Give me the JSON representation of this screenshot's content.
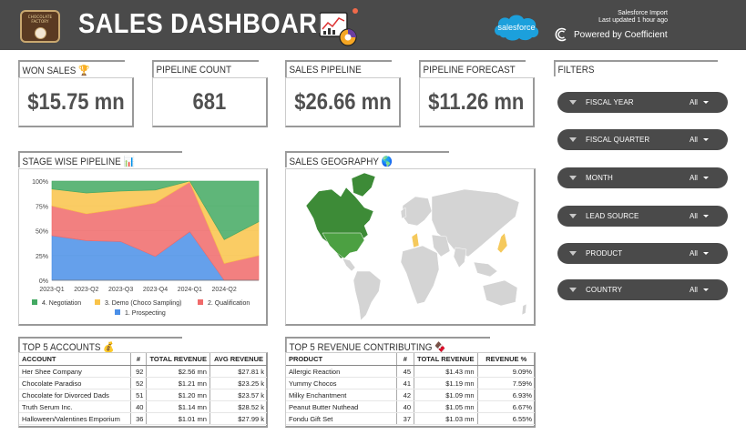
{
  "header": {
    "title": "SALES DASHBOARD",
    "logo_text": "CHOCOLATE FACTORY",
    "integration": "Salesforce Import",
    "last_updated": "Last updated 1 hour ago",
    "salesforce_logo": "salesforce",
    "powered_by": "Powered by Coefficient"
  },
  "kpis": {
    "won_sales": {
      "label": "WON SALES 🏆",
      "value": "$15.75 mn"
    },
    "pipeline_count": {
      "label": "PIPELINE COUNT",
      "value": "681"
    },
    "sales_pipeline": {
      "label": "SALES PIPELINE",
      "value": "$26.66 mn"
    },
    "pipeline_forecast": {
      "label": "PIPELINE FORECAST",
      "value": "$11.26 mn"
    }
  },
  "sections": {
    "stage_pipeline": "STAGE WISE PIPELINE 📊",
    "sales_geography": "SALES GEOGRAPHY 🌎",
    "top_accounts": "TOP 5 ACCOUNTS 💰",
    "top_revenue": "TOP 5 REVENUE CONTRIBUTING 🍫",
    "filters": "FILTERS"
  },
  "filters": [
    {
      "name": "FISCAL YEAR",
      "value": "All"
    },
    {
      "name": "FISCAL QUARTER",
      "value": "All"
    },
    {
      "name": "MONTH",
      "value": "All"
    },
    {
      "name": "LEAD SOURCE",
      "value": "All"
    },
    {
      "name": "PRODUCT",
      "value": "All"
    },
    {
      "name": "COUNTRY",
      "value": "All"
    }
  ],
  "accounts_table": {
    "columns": [
      "ACCOUNT",
      "#",
      "TOTAL REVENUE",
      "AVG REVENUE"
    ],
    "rows": [
      [
        "Her Shee Company",
        "92",
        "$2.56 mn",
        "$27.81 k"
      ],
      [
        "Chocolate Paradiso",
        "52",
        "$1.21 mn",
        "$23.25 k"
      ],
      [
        "Chocolate for Divorced Dads",
        "51",
        "$1.20 mn",
        "$23.57 k"
      ],
      [
        "Truth Serum Inc.",
        "40",
        "$1.14 mn",
        "$28.52 k"
      ],
      [
        "Halloween/Valentines Emporium",
        "36",
        "$1.01 mn",
        "$27.99 k"
      ]
    ]
  },
  "products_table": {
    "columns": [
      "PRODUCT",
      "#",
      "TOTAL REVENUE",
      "REVENUE %"
    ],
    "rows": [
      [
        "Allergic Reaction",
        "45",
        "$1.43 mn",
        "9.09%"
      ],
      [
        "Yummy Chocos",
        "41",
        "$1.19 mn",
        "7.59%"
      ],
      [
        "Milky Enchantment",
        "42",
        "$1.09 mn",
        "6.93%"
      ],
      [
        "Peanut Butter Nuthead",
        "40",
        "$1.05 mn",
        "6.67%"
      ],
      [
        "Fondu Gift Set",
        "37",
        "$1.03 mn",
        "6.55%"
      ]
    ]
  },
  "chart_data": {
    "type": "area",
    "stacked": "percent",
    "categories": [
      "2023-Q1",
      "2023-Q2",
      "2023-Q3",
      "2023-Q4",
      "2024-Q1",
      "2024-Q2"
    ],
    "yticks": [
      "0%",
      "25%",
      "50%",
      "75%",
      "100%"
    ],
    "ylim": [
      0,
      100
    ],
    "series": [
      {
        "name": "1. Prospecting",
        "color": "#4a8fe8",
        "values": [
          45,
          40,
          39,
          24,
          49,
          0,
          0
        ]
      },
      {
        "name": "2. Qualification",
        "color": "#f06a6a",
        "values": [
          30,
          27,
          33,
          54,
          50,
          17,
          25
        ]
      },
      {
        "name": "3. Demo (Choco Sampling)",
        "color": "#f9c349",
        "values": [
          17,
          21,
          18,
          13,
          1,
          24,
          34
        ]
      },
      {
        "name": "4. Negotiation",
        "color": "#43a962",
        "values": [
          8,
          12,
          10,
          9,
          0,
          59,
          41
        ]
      }
    ],
    "legend_order": [
      "4. Negotiation",
      "3. Demo (Choco Sampling)",
      "2. Qualification",
      "1. Prospecting"
    ],
    "legend": "bottom",
    "grid": true
  },
  "geo_map": {
    "highlight_color": "#3d8b37",
    "secondary_color": "#f5c95c",
    "base_color": "#d4d4d4"
  }
}
